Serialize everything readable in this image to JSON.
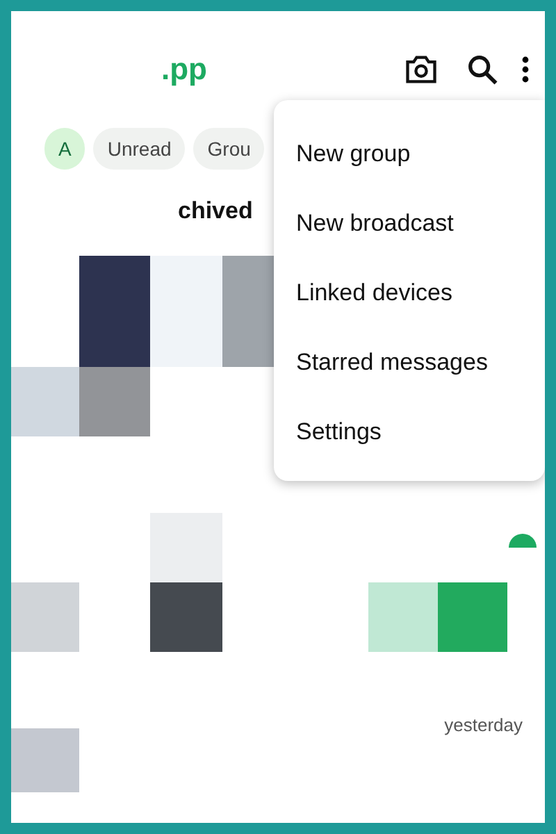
{
  "app_bar": {
    "title": ".pp"
  },
  "filters": [
    {
      "label": "A",
      "selected": true
    },
    {
      "label": "Unread",
      "selected": false
    },
    {
      "label": "Grou",
      "selected": false
    }
  ],
  "archived": {
    "label": "chived"
  },
  "chat_list": [
    {
      "time": "yesterday"
    }
  ],
  "menu": {
    "items": [
      "New group",
      "New broadcast",
      "Linked devices",
      "Starred messages",
      "Settings"
    ]
  }
}
